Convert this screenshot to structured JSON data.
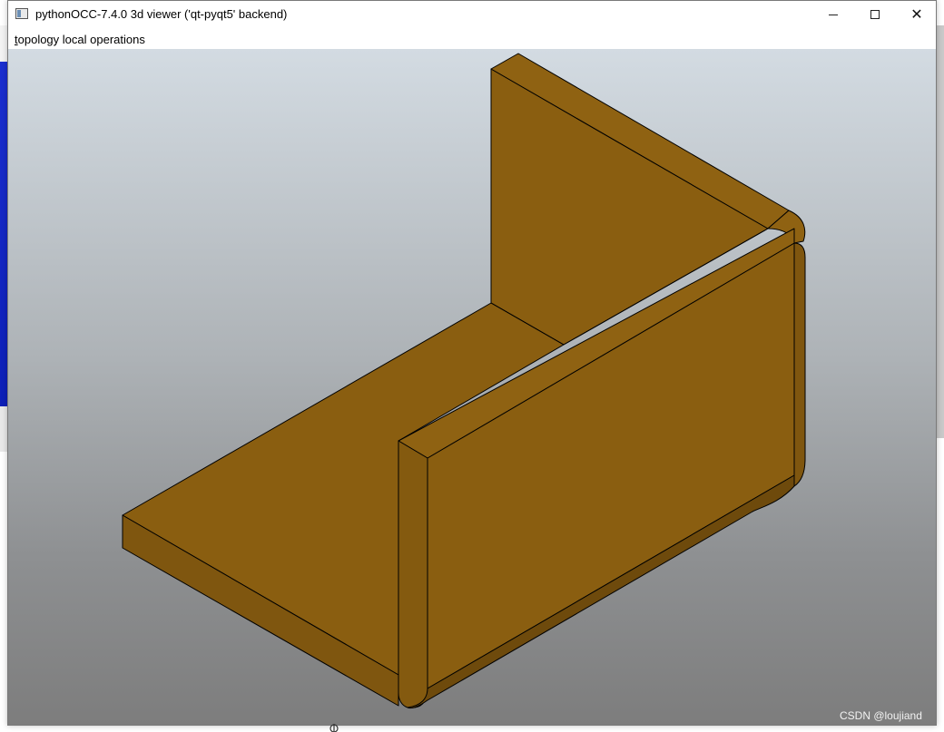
{
  "window": {
    "title": "pythonOCC-7.4.0 3d viewer ('qt-pyqt5' backend)",
    "icon": "app-window-icon",
    "controls": {
      "minimize_icon": "minimize-icon",
      "maximize_icon": "maximize-icon",
      "close_icon": "close-icon",
      "close_glyph": "✕"
    }
  },
  "menubar": {
    "items": [
      {
        "label": "topology local operations",
        "mnemonic": "t"
      }
    ]
  },
  "viewport": {
    "background_top": "#d3dbe2",
    "background_bottom": "#7d7d7d",
    "model": {
      "description_name": "bent-sheet-solid",
      "face_color": "#8a5e10",
      "face_color_dark": "#6e4a0c",
      "edge_color": "#000000"
    }
  },
  "watermark": "CSDN @loujiand"
}
